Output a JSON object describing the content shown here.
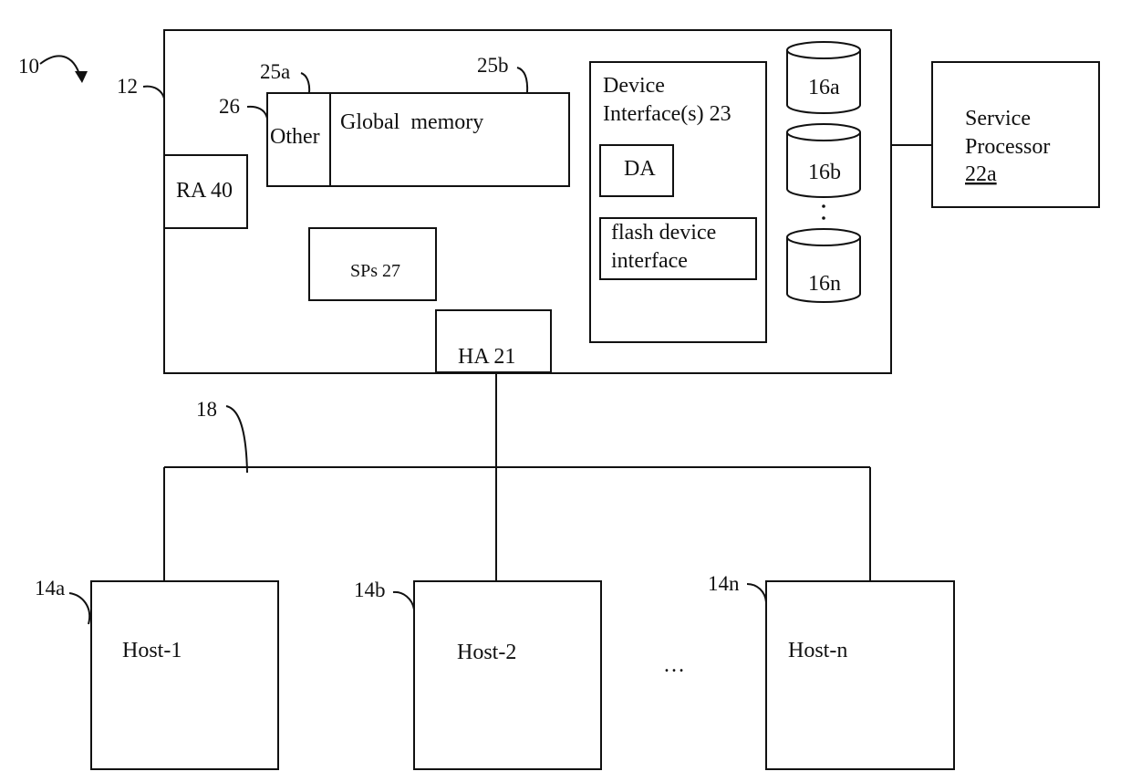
{
  "diagram": {
    "system_ref": "10",
    "storage_system": {
      "ref": "12"
    },
    "global_memory": {
      "label": "Global  memory",
      "ref": "25b"
    },
    "other": {
      "label": "Other",
      "ref": "25a",
      "group_ref": "26"
    },
    "ra": {
      "label": "RA 40"
    },
    "sps": {
      "label": "SPs 27"
    },
    "ha": {
      "label": "HA 21"
    },
    "device_interfaces": {
      "label_line1": "Device",
      "label_line2": "Interface(s) 23",
      "da": {
        "label": "DA"
      },
      "flash": {
        "label_line1": "flash device",
        "label_line2": "interface"
      }
    },
    "disks": [
      {
        "label": "16a"
      },
      {
        "label": "16b"
      },
      {
        "label": "16n"
      }
    ],
    "disk_ellipsis": ":",
    "service_processor": {
      "label_line1": "Service",
      "label_line2": "Processor",
      "ref": "22a"
    },
    "network": {
      "ref": "18"
    },
    "hosts": [
      {
        "label": "Host-1",
        "ref": "14a"
      },
      {
        "label": "Host-2",
        "ref": "14b"
      },
      {
        "label": "Host-n",
        "ref": "14n"
      }
    ],
    "host_ellipsis": "…"
  }
}
